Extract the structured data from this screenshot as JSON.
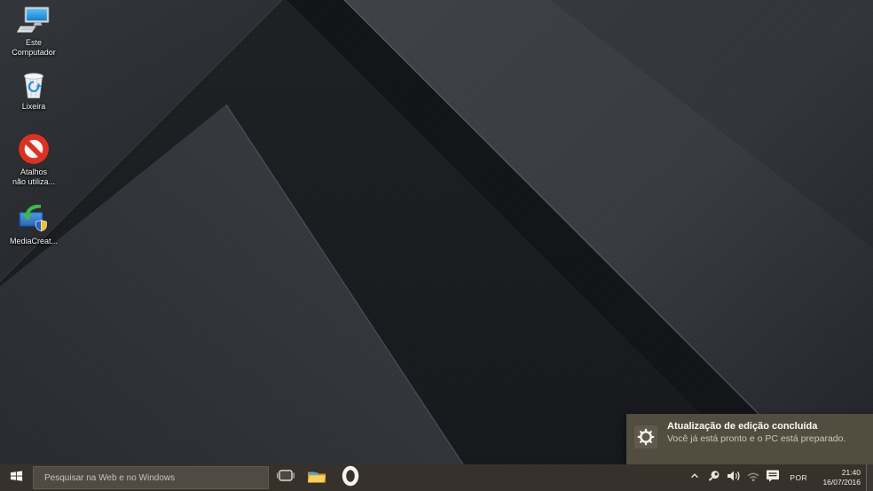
{
  "desktop": {
    "icons": [
      {
        "icon": "this-pc-icon",
        "lines": [
          "Este",
          "Computador"
        ]
      },
      {
        "icon": "recycle-bin-icon",
        "lines": [
          "Lixeira",
          ""
        ]
      },
      {
        "icon": "blocked-shortcuts-icon",
        "lines": [
          "Atalhos",
          "não utiliza..."
        ]
      },
      {
        "icon": "media-creation-tool-icon",
        "lines": [
          "MediaCreat...",
          ""
        ]
      }
    ]
  },
  "notification": {
    "icon": "gear-icon",
    "title": "Atualização de edição concluída",
    "body": "Você já está pronto e o PC está preparado."
  },
  "taskbar": {
    "search_placeholder": "Pesquisar na Web e no Windows",
    "buttons": [
      "windows-logo-icon",
      "task-view-icon",
      "file-explorer-icon",
      "opera-icon"
    ],
    "tray_icons": [
      "chevron-up-icon",
      "usb-device-icon",
      "volume-icon",
      "network-icon",
      "action-center-icon"
    ],
    "language": "POR",
    "clock": {
      "time": "21:40",
      "date": "16/07/2016"
    }
  },
  "colors": {
    "taskbar_bg": "#36322b",
    "search_box_bg": "#4f4b43",
    "toast_bg": "#524d3f",
    "prohibition_red": "#da3222",
    "windows_blue": "#2f8fd8",
    "wallpaper_dark": "#121418"
  }
}
